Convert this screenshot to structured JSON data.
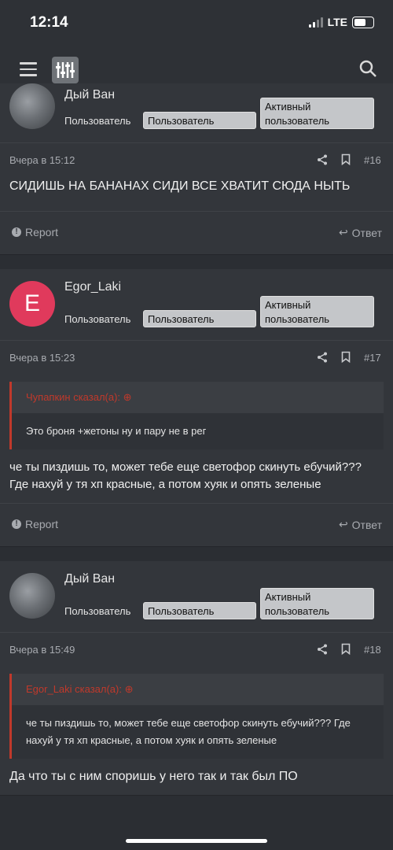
{
  "status": {
    "time": "12:14",
    "network": "LTE"
  },
  "appbar": {
    "menu_icon": "menu-icon",
    "logo_icon": "forum-logo-icon",
    "search_icon": "search-icon"
  },
  "posts": [
    {
      "username": "Дый Ван",
      "user_title": "Пользователь",
      "badge1": "Пользователь",
      "badge2": "Активный пользователь",
      "date": "Вчера в 15:12",
      "number": "#16",
      "body": "СИДИШЬ НА БАНАНАХ СИДИ ВСЕ ХВАТИТ СЮДА НЫТЬ",
      "report": "Report",
      "reply": "Ответ"
    },
    {
      "username": "Egor_Laki",
      "avatar_letter": "E",
      "user_title": "Пользователь",
      "badge1": "Пользователь",
      "badge2": "Активный пользователь",
      "date": "Вчера в 15:23",
      "number": "#17",
      "quote_author": "Чупапкин сказал(а):",
      "quote_text": "Это броня +жетоны ну и пару не в рег",
      "body": "че ты пиздишь то, может тебе еще светофор скинуть ебучий??? Где нахуй у тя хп красные, а потом хуяк и опять зеленые",
      "report": "Report",
      "reply": "Ответ"
    },
    {
      "username": "Дый Ван",
      "user_title": "Пользователь",
      "badge1": "Пользователь",
      "badge2": "Активный пользователь",
      "date": "Вчера в 15:49",
      "number": "#18",
      "quote_author": "Egor_Laki сказал(а):",
      "quote_text": "че ты пиздишь то, может тебе еще светофор скинуть ебучий??? Где нахуй у тя хп красные, а потом хуяк и опять зеленые",
      "body": "Да что ты с ним споришь у него так и так был ПО"
    }
  ],
  "colors": {
    "accent_red": "#c0392b",
    "avatar_pink": "#e03a5c",
    "background": "#2b2e33"
  }
}
